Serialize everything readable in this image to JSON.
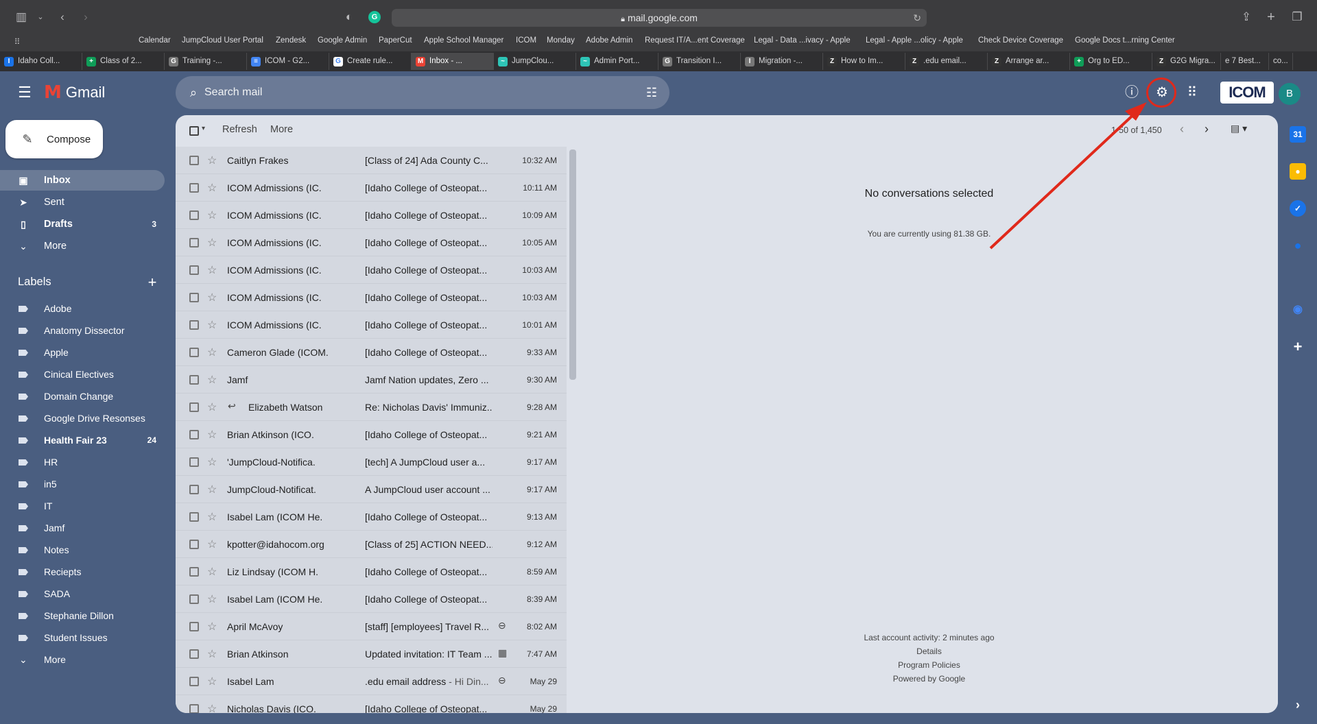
{
  "browser": {
    "url": "mail.google.com",
    "favorites": [
      "Calendar",
      "JumpCloud User Portal",
      "Zendesk",
      "Google Admin",
      "PaperCut",
      "Apple School Manager",
      "ICOM",
      "Monday",
      "Adobe Admin",
      "Request IT/A...ent Coverage",
      "Legal - Data ...ivacy - Apple",
      "Legal - Apple ...olicy - Apple",
      "Check Device Coverage",
      "Google Docs t...rning Center"
    ],
    "tabs": [
      {
        "label": "Idaho Coll...",
        "icon": "I",
        "color": "#1a73e8"
      },
      {
        "label": "Class of 2...",
        "icon": "+",
        "color": "#0f9d58"
      },
      {
        "label": "Training -...",
        "icon": "G",
        "color": "#777777"
      },
      {
        "label": "ICOM - G2...",
        "icon": "≡",
        "color": "#4285f4"
      },
      {
        "label": "Create rule...",
        "icon": "G",
        "color": "#ffffff"
      },
      {
        "label": "Inbox - ...",
        "icon": "M",
        "color": "#ea4335"
      },
      {
        "label": "JumpClou...",
        "icon": "~",
        "color": "#2ec4b6"
      },
      {
        "label": "Admin Port...",
        "icon": "~",
        "color": "#2ec4b6"
      },
      {
        "label": "Transition I...",
        "icon": "G",
        "color": "#777777"
      },
      {
        "label": "Migration -...",
        "icon": "I",
        "color": "#777777"
      },
      {
        "label": "How to Im...",
        "icon": "Z",
        "color": "#333333"
      },
      {
        "label": ".edu email...",
        "icon": "Z",
        "color": "#333333"
      },
      {
        "label": "Arrange ar...",
        "icon": "Z",
        "color": "#333333"
      },
      {
        "label": "Org to ED...",
        "icon": "+",
        "color": "#0f9d58"
      },
      {
        "label": "G2G Migra...",
        "icon": "Z",
        "color": "#333333"
      },
      {
        "label": "e 7 Best...",
        "icon": "",
        "color": "#2f2f31"
      },
      {
        "label": "co...",
        "icon": "",
        "color": "#2f2f31"
      }
    ]
  },
  "gmail": {
    "brand": "Gmail",
    "search_placeholder": "Search mail",
    "org_logo": "ICOM",
    "avatar_letter": "B",
    "compose_label": "Compose",
    "nav": [
      {
        "label": "Inbox",
        "count": "",
        "icon": "inbox-icon",
        "glyph": "▣"
      },
      {
        "label": "Sent",
        "count": "",
        "icon": "send-icon",
        "glyph": "➤"
      },
      {
        "label": "Drafts",
        "count": "3",
        "icon": "draft-icon",
        "glyph": "▯"
      },
      {
        "label": "More",
        "count": "",
        "icon": "chevron-down-icon",
        "glyph": "⌄"
      }
    ],
    "labels_title": "Labels",
    "labels": [
      {
        "label": "Adobe",
        "count": ""
      },
      {
        "label": "Anatomy Dissector",
        "count": ""
      },
      {
        "label": "Apple",
        "count": ""
      },
      {
        "label": "Cinical Electives",
        "count": ""
      },
      {
        "label": "Domain Change",
        "count": ""
      },
      {
        "label": "Google Drive Resonses",
        "count": ""
      },
      {
        "label": "Health Fair 23",
        "count": "24"
      },
      {
        "label": "HR",
        "count": ""
      },
      {
        "label": "in5",
        "count": ""
      },
      {
        "label": "IT",
        "count": ""
      },
      {
        "label": "Jamf",
        "count": ""
      },
      {
        "label": "Notes",
        "count": ""
      },
      {
        "label": "Reciepts",
        "count": ""
      },
      {
        "label": "SADA",
        "count": ""
      },
      {
        "label": "Stephanie Dillon",
        "count": ""
      },
      {
        "label": "Student Issues",
        "count": ""
      }
    ],
    "labels_more": "More",
    "toolbar": {
      "refresh": "Refresh",
      "more": "More",
      "page_count": "1-50 of 1,450"
    },
    "emails": [
      {
        "sender": "Caitlyn Frakes",
        "subject": "[Class of 24] Ada County C...",
        "snippet": "",
        "time": "10:32 AM",
        "reply": false,
        "attachment": ""
      },
      {
        "sender": "ICOM Admissions (IC.",
        "subject": "[Idaho College of Osteopat...",
        "snippet": "",
        "time": "10:11 AM",
        "reply": false,
        "attachment": ""
      },
      {
        "sender": "ICOM Admissions (IC.",
        "subject": "[Idaho College of Osteopat...",
        "snippet": "",
        "time": "10:09 AM",
        "reply": false,
        "attachment": ""
      },
      {
        "sender": "ICOM Admissions (IC.",
        "subject": "[Idaho College of Osteopat...",
        "snippet": "",
        "time": "10:05 AM",
        "reply": false,
        "attachment": ""
      },
      {
        "sender": "ICOM Admissions (IC.",
        "subject": "[Idaho College of Osteopat...",
        "snippet": "",
        "time": "10:03 AM",
        "reply": false,
        "attachment": ""
      },
      {
        "sender": "ICOM Admissions (IC.",
        "subject": "[Idaho College of Osteopat...",
        "snippet": "",
        "time": "10:03 AM",
        "reply": false,
        "attachment": ""
      },
      {
        "sender": "ICOM Admissions (IC.",
        "subject": "[Idaho College of Osteopat...",
        "snippet": "",
        "time": "10:01 AM",
        "reply": false,
        "attachment": ""
      },
      {
        "sender": "Cameron Glade (ICOM.",
        "subject": "[Idaho College of Osteopat...",
        "snippet": "",
        "time": "9:33 AM",
        "reply": false,
        "attachment": ""
      },
      {
        "sender": "Jamf",
        "subject": "Jamf Nation updates, Zero ...",
        "snippet": "",
        "time": "9:30 AM",
        "reply": false,
        "attachment": ""
      },
      {
        "sender": "Elizabeth Watson",
        "subject": "Re: Nicholas Davis' Immuniz...",
        "snippet": "",
        "time": "9:28 AM",
        "reply": true,
        "attachment": ""
      },
      {
        "sender": "Brian Atkinson (ICO.",
        "subject": "[Idaho College of Osteopat...",
        "snippet": "",
        "time": "9:21 AM",
        "reply": false,
        "attachment": ""
      },
      {
        "sender": "'JumpCloud-Notifica.",
        "subject": "[tech] A JumpCloud user a...",
        "snippet": "",
        "time": "9:17 AM",
        "reply": false,
        "attachment": ""
      },
      {
        "sender": "JumpCloud-Notificat.",
        "subject": "A JumpCloud user account ...",
        "snippet": "",
        "time": "9:17 AM",
        "reply": false,
        "attachment": ""
      },
      {
        "sender": "Isabel Lam (ICOM He.",
        "subject": "[Idaho College of Osteopat...",
        "snippet": "",
        "time": "9:13 AM",
        "reply": false,
        "attachment": ""
      },
      {
        "sender": "kpotter@idahocom.org",
        "subject": "[Class of 25] ACTION NEED...",
        "snippet": "",
        "time": "9:12 AM",
        "reply": false,
        "attachment": ""
      },
      {
        "sender": "Liz Lindsay (ICOM H.",
        "subject": "[Idaho College of Osteopat...",
        "snippet": "",
        "time": "8:59 AM",
        "reply": false,
        "attachment": ""
      },
      {
        "sender": "Isabel Lam (ICOM He.",
        "subject": "[Idaho College of Osteopat...",
        "snippet": "",
        "time": "8:39 AM",
        "reply": false,
        "attachment": ""
      },
      {
        "sender": "April McAvoy",
        "subject": "[staff] [employees] Travel R...",
        "snippet": "",
        "time": "8:02 AM",
        "reply": false,
        "attachment": "paperclip-icon"
      },
      {
        "sender": "Brian Atkinson",
        "subject": "Updated invitation: IT Team ...",
        "snippet": "",
        "time": "7:47 AM",
        "reply": false,
        "attachment": "calendar-icon"
      },
      {
        "sender": "Isabel Lam",
        "subject": ".edu email address",
        "snippet": " - Hi Din...",
        "time": "May 29",
        "reply": false,
        "attachment": "paperclip-icon"
      },
      {
        "sender": "Nicholas Davis (ICO.",
        "subject": "[Idaho College of Osteopat...",
        "snippet": "",
        "time": "May 29",
        "reply": false,
        "attachment": ""
      }
    ],
    "reading": {
      "empty_title": "No conversations selected",
      "storage": "You are currently using 81.38 GB.",
      "activity": "Last account activity: 2 minutes ago",
      "details": "Details",
      "policies": "Program Policies",
      "powered": "Powered by Google"
    }
  },
  "colors": {
    "annotation": "#e0291b",
    "gmail_bg": "#4a5e80"
  }
}
